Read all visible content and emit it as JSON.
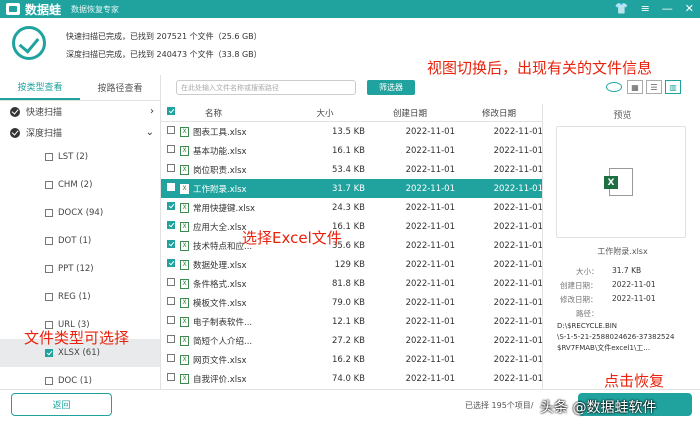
{
  "titlebar": {
    "app": "数据蛙",
    "subtitle": "数据恢复专家",
    "icons": [
      "skin-icon",
      "menu-icon",
      "minimize-icon",
      "close-icon"
    ]
  },
  "scan": {
    "quick": "快速扫描已完成，已找到  207521  个文件（25.6 GB）",
    "deep": "深度扫描已完成，已找到  240473  个文件（33.8 GB）"
  },
  "annotations": {
    "view": "视图切换后，出现有关的文件信息",
    "excel": "选择Excel文件",
    "types": "文件类型可选择",
    "recover": "点击恢复"
  },
  "left": {
    "tab_type": "按类型查看",
    "tab_path": "按路径查看",
    "quick": "快速扫描",
    "deep": "深度扫描",
    "types": [
      {
        "label": "LST (2)",
        "sel": false
      },
      {
        "label": "CHM (2)",
        "sel": false
      },
      {
        "label": "DOCX (94)",
        "sel": false
      },
      {
        "label": "DOT (1)",
        "sel": false
      },
      {
        "label": "PPT (12)",
        "sel": false
      },
      {
        "label": "REG (1)",
        "sel": false
      },
      {
        "label": "URL (3)",
        "sel": false
      },
      {
        "label": "XLSX (61)",
        "sel": true
      },
      {
        "label": "DOC (1)",
        "sel": false
      }
    ]
  },
  "toolbar": {
    "search_placeholder": "在此处输入文件名称或搜索路径",
    "filter": "筛选器"
  },
  "table": {
    "headers": {
      "name": "名称",
      "size": "大小",
      "created": "创建日期",
      "modified": "修改日期"
    },
    "rows": [
      {
        "name": "图表工具.xlsx",
        "size": "13.5 KB",
        "c": "2022-11-01",
        "m": "2022-11-01",
        "chk": false,
        "hl": false
      },
      {
        "name": "基本功能.xlsx",
        "size": "16.1 KB",
        "c": "2022-11-01",
        "m": "2022-11-01",
        "chk": false,
        "hl": false
      },
      {
        "name": "岗位职责.xlsx",
        "size": "53.4 KB",
        "c": "2022-11-01",
        "m": "2022-11-01",
        "chk": false,
        "hl": false
      },
      {
        "name": "工作附录.xlsx",
        "size": "31.7 KB",
        "c": "2022-11-01",
        "m": "2022-11-01",
        "chk": true,
        "hl": true
      },
      {
        "name": "常用快捷键.xlsx",
        "size": "24.3 KB",
        "c": "2022-11-01",
        "m": "2022-11-01",
        "chk": true,
        "hl": false
      },
      {
        "name": "应用大全.xlsx",
        "size": "16.1 KB",
        "c": "2022-11-01",
        "m": "2022-11-01",
        "chk": true,
        "hl": false
      },
      {
        "name": "技术特点和应...",
        "size": "35.6 KB",
        "c": "2022-11-01",
        "m": "2022-11-01",
        "chk": true,
        "hl": false
      },
      {
        "name": "数据处理.xlsx",
        "size": "129 KB",
        "c": "2022-11-01",
        "m": "2022-11-01",
        "chk": true,
        "hl": false
      },
      {
        "name": "条件格式.xlsx",
        "size": "81.8 KB",
        "c": "2022-11-01",
        "m": "2022-11-01",
        "chk": false,
        "hl": false
      },
      {
        "name": "模板文件.xlsx",
        "size": "79.0 KB",
        "c": "2022-11-01",
        "m": "2022-11-01",
        "chk": false,
        "hl": false
      },
      {
        "name": "电子制表软件...",
        "size": "12.1 KB",
        "c": "2022-11-01",
        "m": "2022-11-01",
        "chk": false,
        "hl": false
      },
      {
        "name": "简短个人介绍...",
        "size": "27.2 KB",
        "c": "2022-11-01",
        "m": "2022-11-01",
        "chk": false,
        "hl": false
      },
      {
        "name": "网页文件.xlsx",
        "size": "16.2 KB",
        "c": "2022-11-01",
        "m": "2022-11-01",
        "chk": false,
        "hl": false
      },
      {
        "name": "自我评价.xlsx",
        "size": "74.0 KB",
        "c": "2022-11-01",
        "m": "2022-11-01",
        "chk": false,
        "hl": false
      }
    ]
  },
  "preview": {
    "title": "预览",
    "filename": "工作附录.xlsx",
    "size_label": "大小：",
    "size": "31.7 KB",
    "created_label": "创建日期：",
    "created": "2022-11-01",
    "modified_label": "修改日期：",
    "modified": "2022-11-01",
    "path_label": "路径：",
    "path_lines": [
      "D:\\$RECYCLE.BIN",
      "\\S-1-5-21-2588024626-37382524",
      "$RV7FMAB\\文件excel1\\工..."
    ]
  },
  "bottom": {
    "back": "返回",
    "selected": "已选择 195个项目/",
    "watermark": "头条 @数据蛙软件",
    "watermark_top": "数据蛙软件"
  }
}
